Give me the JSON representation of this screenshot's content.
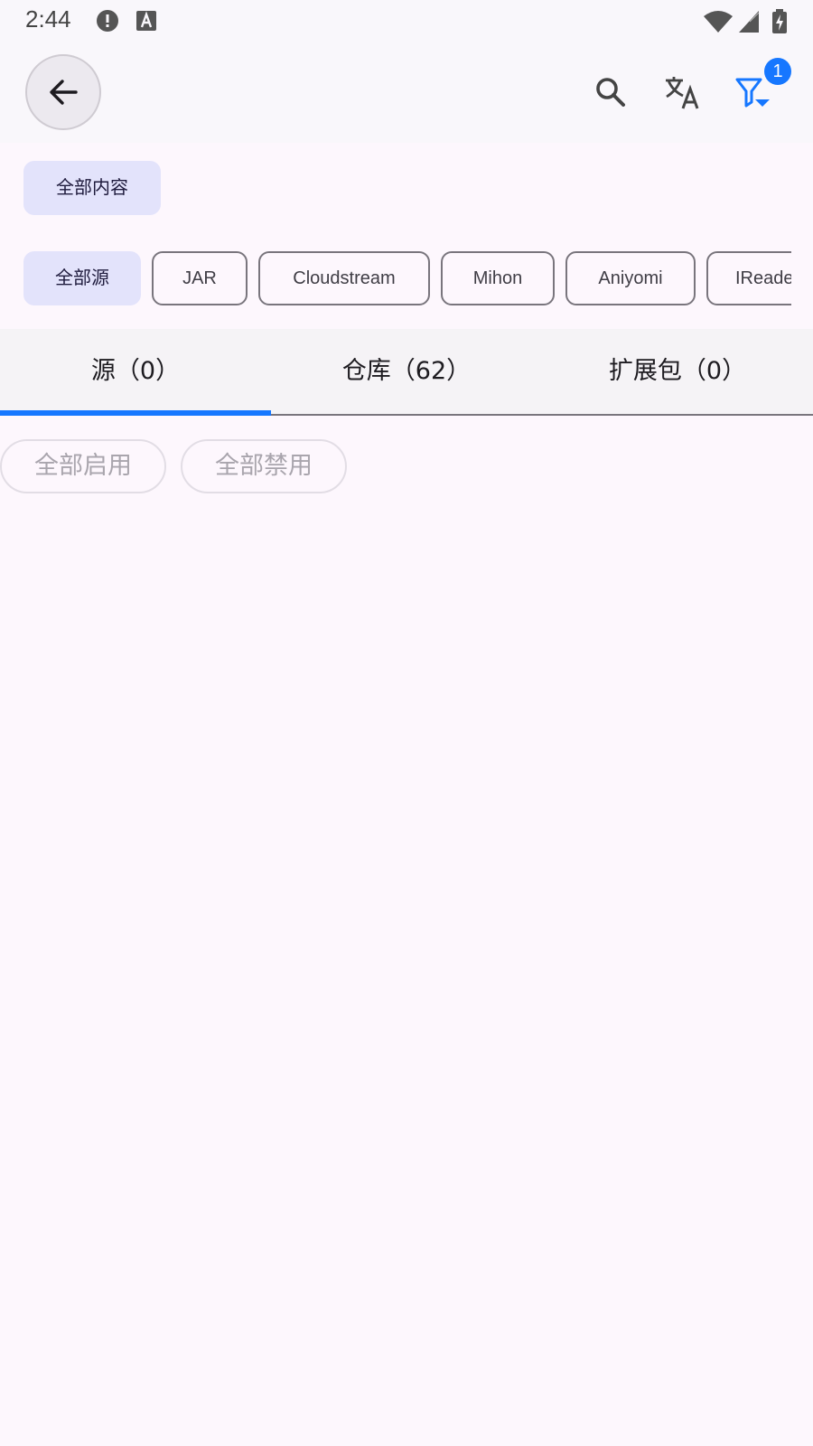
{
  "status_bar": {
    "time": "2:44",
    "icons": [
      "alert-icon",
      "font-a-icon",
      "wifi-icon",
      "cell-signal-icon",
      "battery-charging-icon"
    ]
  },
  "app_bar": {
    "back_icon": "arrow-left-icon",
    "actions": [
      "search-icon",
      "translate-icon",
      "filter-icon"
    ],
    "filter_badge": "1",
    "accent_color": "#1677ff"
  },
  "content_filter": {
    "label": "全部内容"
  },
  "source_filters": [
    {
      "label": "全部源",
      "selected": true
    },
    {
      "label": "JAR",
      "selected": false
    },
    {
      "label": "Cloudstream",
      "selected": false
    },
    {
      "label": "Mihon",
      "selected": false
    },
    {
      "label": "Aniyomi",
      "selected": false
    },
    {
      "label": "IReader",
      "selected": false
    }
  ],
  "tabs": [
    {
      "label": "源（0）",
      "active": true
    },
    {
      "label": "仓库（62）",
      "active": false
    },
    {
      "label": "扩展包（0）",
      "active": false
    }
  ],
  "bulk_actions": {
    "enable_all": "全部启用",
    "disable_all": "全部禁用"
  }
}
